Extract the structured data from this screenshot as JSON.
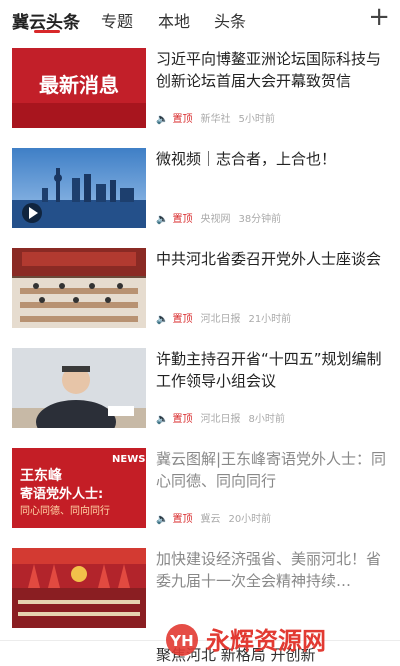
{
  "tabs": [
    {
      "label": "冀云头条",
      "active": true
    },
    {
      "label": "专题",
      "active": false
    },
    {
      "label": "本地",
      "active": false
    },
    {
      "label": "头条",
      "active": false
    }
  ],
  "add_icon": "plus-icon",
  "accent_color": "#d8282a",
  "news": [
    {
      "title": "习近平向博鳌亚洲论坛国际科技与创新论坛首届大会开幕致贺信",
      "thumb_text": "最新消息",
      "pin": "置顶",
      "source": "新华社",
      "time": "5小时前",
      "read": false
    },
    {
      "title": "微视频｜志合者，上合也！",
      "pin": "置顶",
      "source": "央视网",
      "time": "38分钟前",
      "read": false
    },
    {
      "title": "中共河北省委召开党外人士座谈会",
      "pin": "置顶",
      "source": "河北日报",
      "time": "21小时前",
      "read": false
    },
    {
      "title": "许勤主持召开省“十四五”规划编制工作领导小组会议",
      "pin": "置顶",
      "source": "河北日报",
      "time": "8小时前",
      "read": false
    },
    {
      "title": "冀云图解|王东峰寄语党外人士：同心同德、同向同行",
      "thumb_lines": [
        "NEWS",
        "王东峰",
        "寄语党外人士:",
        "同心同德、同向同行"
      ],
      "pin": "置顶",
      "source": "冀云",
      "time": "20小时前",
      "read": true
    },
    {
      "title": "加快建设经济强省、美丽河北！省委九届十一次全会精神持续…",
      "read": true
    }
  ],
  "last_item_partial": "聚焦河北 新格局 开创新",
  "watermark": {
    "logo": "YH",
    "text": "永辉资源网"
  }
}
